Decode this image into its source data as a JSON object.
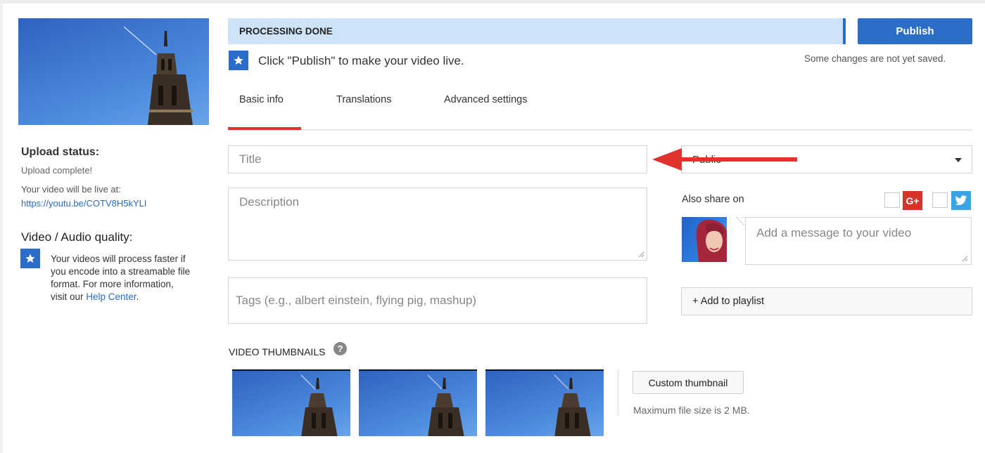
{
  "sidebar": {
    "upload_status_heading": "Upload status:",
    "upload_status_text": "Upload complete!",
    "live_at_text": "Your video will be live at:",
    "video_url": "https://youtu.be/COTV8H5kYLI",
    "quality_heading": "Video / Audio quality:",
    "quality_text": "Your videos will process faster if you encode into a streamable file format. For more information, visit our",
    "help_link": "Help Center",
    "quality_text_end": "."
  },
  "header": {
    "processing_status": "PROCESSING DONE",
    "publish_label": "Publish",
    "unsaved_notice": "Some changes are not yet saved.",
    "publish_hint": "Click \"Publish\" to make your video live."
  },
  "tabs": [
    {
      "label": "Basic info",
      "active": true
    },
    {
      "label": "Translations",
      "active": false
    },
    {
      "label": "Advanced settings",
      "active": false
    }
  ],
  "form": {
    "title_placeholder": "Title",
    "description_placeholder": "Description",
    "tags_placeholder": "Tags (e.g., albert einstein, flying pig, mashup)",
    "privacy_value": "Public",
    "also_share_label": "Also share on",
    "message_placeholder": "Add a message to your video",
    "add_playlist_label": "+ Add to playlist"
  },
  "thumbnails": {
    "heading": "VIDEO THUMBNAILS",
    "custom_button": "Custom thumbnail",
    "max_size_text": "Maximum file size is 2 MB."
  },
  "colors": {
    "accent_blue": "#2b6ec9",
    "processing_bg": "#cfe3f8",
    "tab_underline": "#e0332d",
    "annotation_arrow": "#e0332d",
    "gplus": "#d9322b",
    "twitter": "#3aa3e3"
  },
  "icons": [
    "star-icon",
    "chevron-down-icon",
    "google-plus-icon",
    "twitter-icon",
    "help-icon",
    "arrow-annotation-icon"
  ]
}
